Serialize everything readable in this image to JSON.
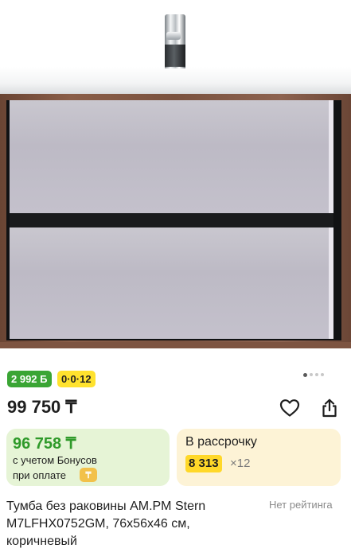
{
  "product": {
    "image_alt": "product-photo",
    "gallery": {
      "total": 5,
      "active": 1
    },
    "title": "Тумба без раковины AM.PM Stern M7LFHX0752GM, 76х56х46 см, коричневый",
    "rating_text": "Нет рейтинга"
  },
  "badges": {
    "bonus": "2 992 Б",
    "installment": "0·0·12"
  },
  "price": {
    "value": "99 750 ₸"
  },
  "actions": {
    "favorite_icon": "heart-icon",
    "share_icon": "share-icon"
  },
  "bonus_card": {
    "price": "96 758 ₸",
    "line1": "с учетом Бонусов",
    "line2": "при оплате",
    "pay_icon": "₸"
  },
  "installment_card": {
    "title": "В рассрочку",
    "amount": "8 313",
    "multiplier": "×12"
  },
  "colors": {
    "bonus_green": "#3aa534",
    "installment_yellow": "#ffe22e",
    "bonus_card_bg": "#e6f4d6",
    "installment_card_bg": "#fdf3d6"
  }
}
